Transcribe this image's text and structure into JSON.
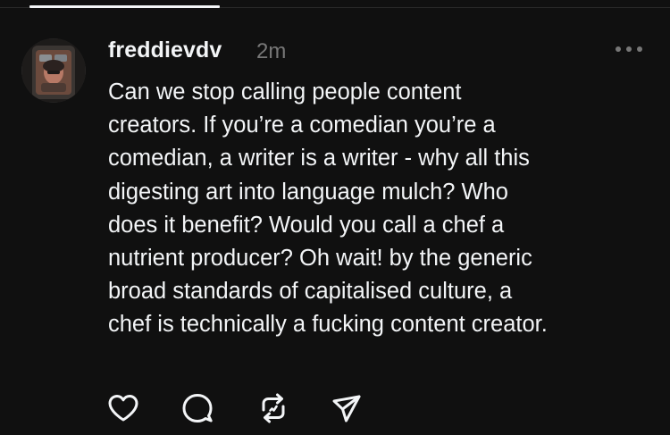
{
  "colors": {
    "background": "#101010",
    "text_primary": "#f3f5f7",
    "text_secondary": "#777777",
    "divider": "#2a2a2a"
  },
  "post": {
    "username": "freddievdv",
    "timestamp": "2m",
    "text": "Can we stop calling people content\ncreators. If you’re a comedian you’re a\ncomedian, a writer is a writer - why all this\ndigesting art into language mulch? Who\ndoes it benefit? Would you call a chef a\nnutrient producer? Oh wait! by the generic\nbroad standards of capitalised culture, a\nchef is technically a fucking content creator.",
    "avatar": "user-avatar-photo",
    "more_icon": "more-horizontal-icon",
    "actions": [
      {
        "name": "like",
        "icon": "heart-icon"
      },
      {
        "name": "reply",
        "icon": "comment-bubble-icon"
      },
      {
        "name": "repost",
        "icon": "repost-icon"
      },
      {
        "name": "share",
        "icon": "send-icon"
      }
    ]
  }
}
